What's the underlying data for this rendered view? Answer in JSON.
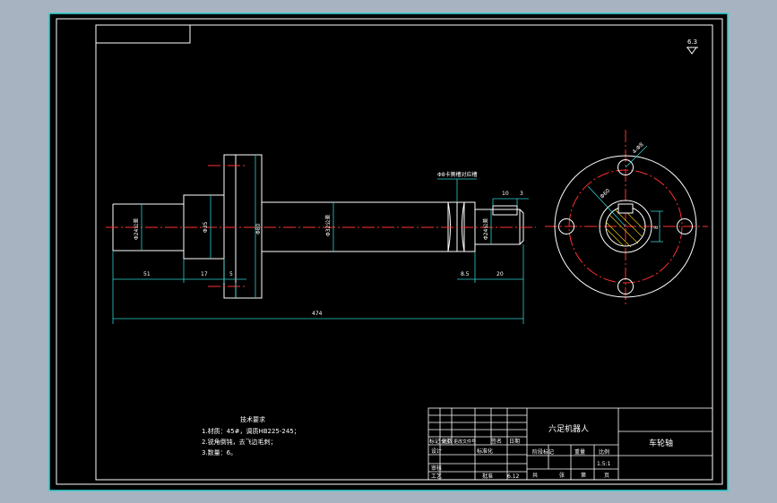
{
  "drawing": {
    "part_name": "车轮轴",
    "assembly_name": "六足机器人",
    "surface_roughness": "6.3"
  },
  "tech_requirements": {
    "title": "技术要求",
    "items": [
      "1.材质：45#，调质HB225-245；",
      "2.锐角倒钝，去飞边毛刺；",
      "3.数量：6。"
    ]
  },
  "dimensions": {
    "total_length": "474",
    "d1": "51",
    "d2": "17",
    "d3": "5",
    "d4": "8.5",
    "d5": "20",
    "d6": "10",
    "d7": "3",
    "dia_left_shaft": "Φ24公差",
    "dia_shoulder": "Φ35",
    "dia_flange": "Φ80",
    "dia_main_shaft": "Φ32公差",
    "dia_right_end": "Φ24公差",
    "groove_note": "Φ8卡簧槽对应槽",
    "hole_note": "4-Φ8",
    "end_dia": "Φ60",
    "key_width": "8"
  },
  "title_block": {
    "mark_count_label": "标记 处数",
    "zone_label": "分区",
    "change_doc_label": "更改文件号",
    "signature_label": "签名",
    "date_label": "日期",
    "designer_label": "设计",
    "standardize_label": "标准化",
    "checker_label": "审核",
    "process_label": "工艺",
    "approve_label": "批准",
    "stage_mark_label": "阶段标记",
    "weight_label": "重量",
    "scale_label": "比例",
    "scale_value": "1.5:1",
    "total_label": "共",
    "sheet_label": "张",
    "page_label": "第",
    "page_suffix": "页",
    "date_value": "6.12"
  }
}
